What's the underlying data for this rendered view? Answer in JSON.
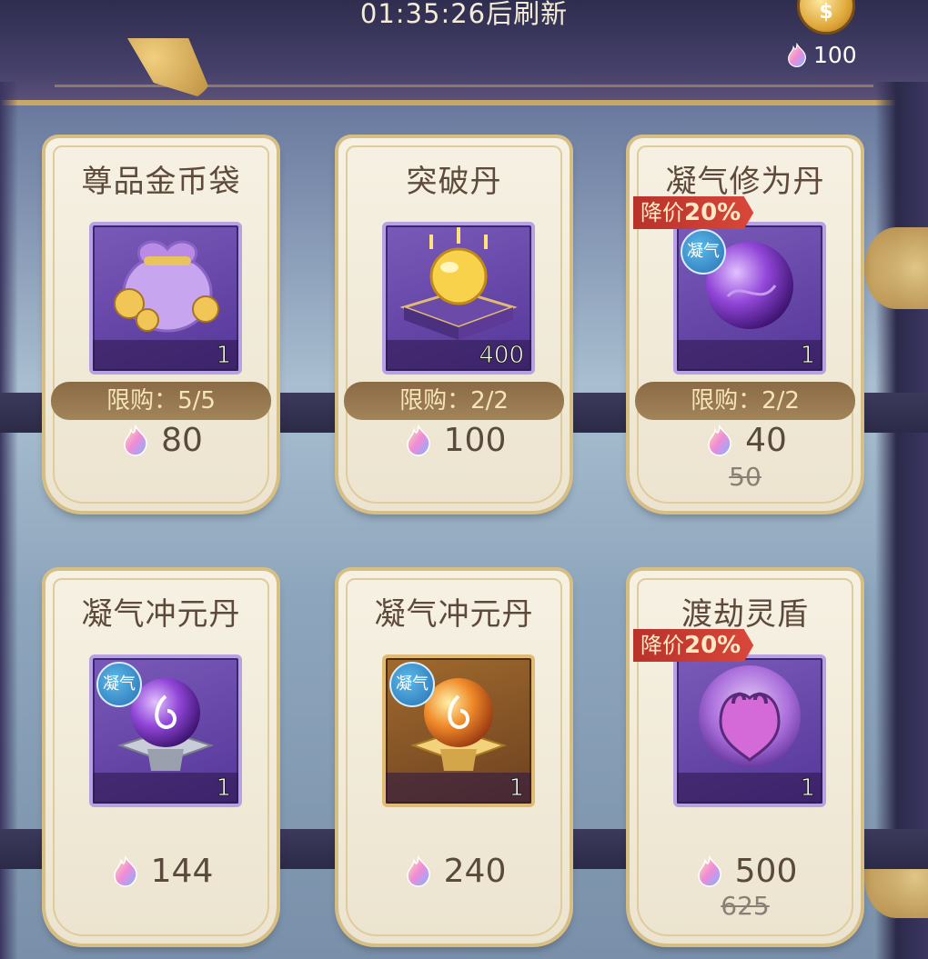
{
  "header": {
    "refresh_text": "01:35:26后刷新"
  },
  "currency": {
    "amount": "100",
    "button_label": "$",
    "icon": "flame-gem-icon"
  },
  "colors": {
    "title": "#5e4a3b",
    "discount_bg": "#c8382f",
    "card_border": "#d7bf84",
    "limit_bg": "#9a7b50"
  },
  "items": [
    {
      "name": "尊品金币袋",
      "icon": "gold-coin-bag-icon",
      "qty": "1",
      "limit": "限购：5/5",
      "price": "80",
      "old_price": "",
      "discount": "",
      "tag": ""
    },
    {
      "name": "突破丹",
      "icon": "golden-pill-on-box-icon",
      "qty": "400",
      "limit": "限购：2/2",
      "price": "100",
      "old_price": "",
      "discount": "",
      "tag": ""
    },
    {
      "name": "凝气修为丹",
      "icon": "purple-orb-icon",
      "qty": "1",
      "limit": "限购：2/2",
      "price": "40",
      "old_price": "50",
      "discount_label": "降价",
      "discount": "20%",
      "tag": "凝气"
    },
    {
      "name": "凝气冲元丹",
      "icon": "purple-orb-stand-icon",
      "qty": "1",
      "limit": "",
      "price": "144",
      "old_price": "",
      "discount": "",
      "tag": "凝气"
    },
    {
      "name": "凝气冲元丹",
      "icon": "orange-orb-stand-icon",
      "qty": "1",
      "limit": "",
      "price": "240",
      "old_price": "",
      "discount": "",
      "tag": "凝气"
    },
    {
      "name": "渡劫灵盾",
      "icon": "spirit-shield-orb-icon",
      "qty": "1",
      "limit": "",
      "price": "500",
      "old_price": "625",
      "discount_label": "降价",
      "discount": "20%",
      "tag": ""
    }
  ]
}
